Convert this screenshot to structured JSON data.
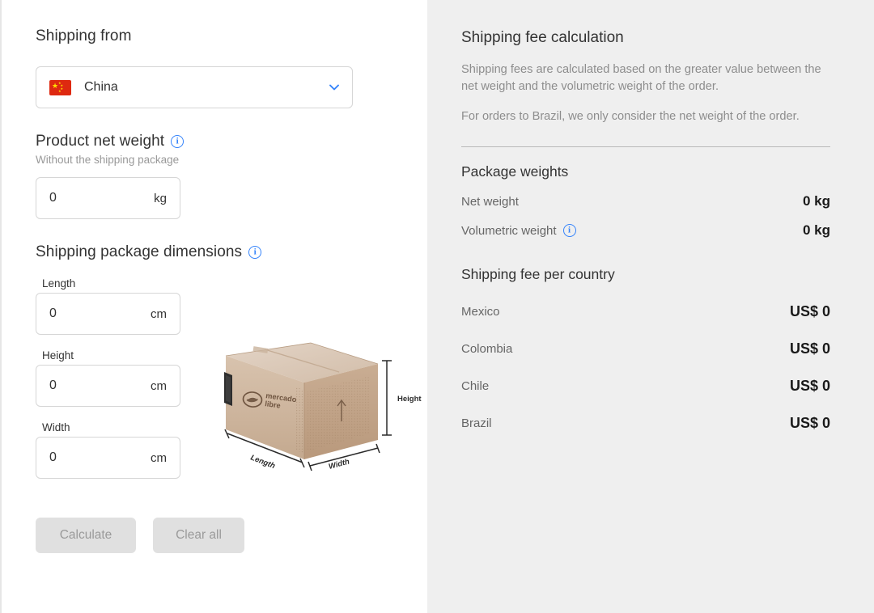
{
  "left": {
    "shipping_from_title": "Shipping from",
    "country": {
      "name": "China",
      "flag_icon": "china-flag-icon",
      "chevron_icon": "chevron-down-icon"
    },
    "net_weight": {
      "title": "Product net weight",
      "info_icon": "info-icon",
      "subtext": "Without the shipping package",
      "value": "0",
      "unit": "kg"
    },
    "dimensions": {
      "title": "Shipping package dimensions",
      "info_icon": "info-icon",
      "unit": "cm",
      "fields": [
        {
          "label": "Length",
          "value": "0",
          "unit": "cm"
        },
        {
          "label": "Height",
          "value": "0",
          "unit": "cm"
        },
        {
          "label": "Width",
          "value": "0",
          "unit": "cm"
        }
      ]
    },
    "buttons": {
      "calculate": "Calculate",
      "clear_all": "Clear all"
    },
    "illustration": {
      "brand_line1": "mercado",
      "brand_line2": "libre",
      "label_height": "Height",
      "label_length": "Length",
      "label_width": "Width"
    }
  },
  "right": {
    "title": "Shipping fee calculation",
    "paragraph_1": "Shipping fees are calculated based on the greater value between the net weight and the volumetric weight of the order.",
    "paragraph_2": "For orders to Brazil, we only consider the net weight of the order.",
    "package_weights": {
      "title": "Package weights",
      "rows": [
        {
          "label": "Net weight",
          "value": "0 kg",
          "has_info": false
        },
        {
          "label": "Volumetric weight",
          "value": "0 kg",
          "has_info": true
        }
      ]
    },
    "fees": {
      "title": "Shipping fee per country",
      "rows": [
        {
          "country": "Mexico",
          "amount": "US$ 0"
        },
        {
          "country": "Colombia",
          "amount": "US$ 0"
        },
        {
          "country": "Chile",
          "amount": "US$ 0"
        },
        {
          "country": "Brazil",
          "amount": "US$ 0"
        }
      ]
    }
  },
  "colors": {
    "accent_blue": "#3483fa",
    "panel_bg": "#efefef",
    "text_dark": "#333333",
    "text_muted": "#8d8d8d",
    "flag_red": "#de2910",
    "button_bg": "#e0e0e0"
  }
}
